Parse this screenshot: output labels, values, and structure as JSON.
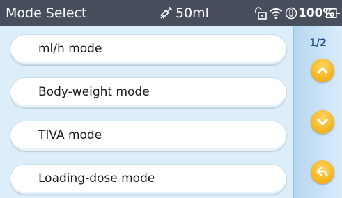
{
  "status_bar": {
    "title": "Mode Select",
    "volume": "50ml",
    "battery": "100%"
  },
  "modes": [
    {
      "label": "ml/h mode"
    },
    {
      "label": "Body-weight mode"
    },
    {
      "label": "TIVA mode"
    },
    {
      "label": "Loading-dose mode"
    }
  ],
  "pagination": {
    "indicator": "1/2"
  },
  "icons": {
    "syringe": "syringe-icon",
    "lock": "lock-icon",
    "wifi": "wifi-icon",
    "pressure": "pressure-icon",
    "plug": "ac-power-icon",
    "up": "chevron-up-icon",
    "down": "chevron-down-icon",
    "back": "back-arrow-icon"
  },
  "colors": {
    "status_bar_bg": "#474e5c",
    "list_bg": "#dceef9",
    "side_panel_bg": "#c7e1f6",
    "nav_button": "#f3b21b",
    "page_indicator": "#1f4f8a"
  }
}
